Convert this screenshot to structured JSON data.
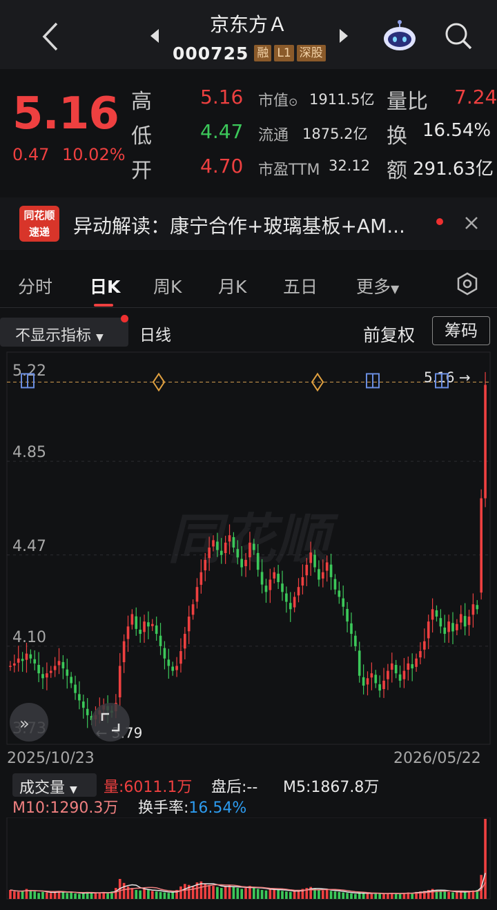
{
  "header": {
    "title": "京东方Ａ",
    "code": "000725",
    "tags": [
      "融",
      "L1",
      "深股"
    ]
  },
  "quote": {
    "price": "5.16",
    "change": "0.47",
    "change_pct": "10.02%",
    "labels": {
      "high": "高",
      "low": "低",
      "open": "开",
      "vol_ratio": "量比",
      "turnover": "换",
      "amount": "额"
    },
    "high": "5.16",
    "low": "4.47",
    "open": "4.70",
    "market_cap_label": "市值",
    "market_cap": "1911.5亿",
    "float_cap_label": "流通",
    "float_cap": "1875.2亿",
    "pe_label": "市盈TTM",
    "pe": "32.12",
    "vol_ratio": "7.24",
    "turnover": "16.54%",
    "amount": "291.63亿"
  },
  "news": {
    "logo_line1": "同花顺",
    "logo_line2": "速递",
    "text": "异动解读：康宁合作+玻璃基板+AM..."
  },
  "tabs": [
    "分时",
    "日K",
    "周K",
    "月K",
    "五日",
    "更多"
  ],
  "active_tab": "日K",
  "subbar": {
    "indicator": "不显示指标",
    "period": "日线",
    "adjust": "前复权",
    "chips": "筹码"
  },
  "chart_data": {
    "type": "candlestick",
    "y_ticks": [
      "5.22",
      "4.85",
      "4.47",
      "4.10",
      "3.73"
    ],
    "ylim": [
      3.73,
      5.22
    ],
    "max_label": "5.16",
    "min_label": "3.79",
    "x_start_label": "2025/10/23",
    "x_end_label": "2026/05/22",
    "watermark": "同花顺",
    "closes": [
      4.02,
      4.03,
      4.05,
      4.04,
      4.07,
      4.05,
      4.03,
      3.99,
      3.97,
      3.99,
      4.0,
      4.02,
      4.04,
      4.01,
      3.98,
      3.95,
      3.91,
      3.88,
      3.85,
      3.82,
      3.8,
      3.82,
      3.84,
      3.86,
      3.84,
      3.83,
      3.87,
      4.02,
      4.12,
      4.18,
      4.23,
      4.17,
      4.15,
      4.2,
      4.18,
      4.19,
      4.15,
      4.1,
      4.05,
      4.02,
      4.0,
      4.02,
      4.08,
      4.15,
      4.22,
      4.27,
      4.34,
      4.4,
      4.45,
      4.5,
      4.53,
      4.49,
      4.47,
      4.52,
      4.55,
      4.5,
      4.46,
      4.42,
      4.45,
      4.52,
      4.49,
      4.41,
      4.35,
      4.32,
      4.37,
      4.4,
      4.36,
      4.32,
      4.28,
      4.25,
      4.3,
      4.34,
      4.38,
      4.43,
      4.48,
      4.42,
      4.37,
      4.4,
      4.44,
      4.38,
      4.33,
      4.3,
      4.26,
      4.2,
      4.15,
      4.1,
      3.98,
      3.94,
      3.97,
      3.99,
      3.95,
      3.92,
      3.96,
      4.0,
      4.03,
      3.99,
      3.96,
      4.0,
      4.03,
      4.01,
      4.05,
      4.08,
      4.12,
      4.2,
      4.25,
      4.22,
      4.18,
      4.15,
      4.2,
      4.16,
      4.19,
      4.23,
      4.18,
      4.22,
      4.27,
      4.25,
      4.7,
      5.16
    ],
    "volumes": [
      18,
      15,
      14,
      16,
      20,
      18,
      15,
      12,
      14,
      13,
      12,
      15,
      16,
      14,
      12,
      13,
      11,
      10,
      12,
      14,
      13,
      11,
      12,
      14,
      13,
      15,
      22,
      40,
      32,
      25,
      22,
      18,
      17,
      20,
      18,
      16,
      15,
      14,
      13,
      12,
      14,
      18,
      25,
      30,
      28,
      26,
      33,
      35,
      30,
      28,
      26,
      24,
      22,
      25,
      28,
      24,
      22,
      20,
      22,
      26,
      24,
      20,
      18,
      17,
      19,
      21,
      18,
      16,
      15,
      14,
      16,
      18,
      20,
      22,
      24,
      20,
      18,
      17,
      19,
      16,
      15,
      14,
      13,
      12,
      11,
      10,
      13,
      12,
      11,
      10,
      12,
      11,
      10,
      11,
      12,
      10,
      11,
      12,
      13,
      12,
      14,
      15,
      16,
      18,
      20,
      18,
      16,
      15,
      14,
      13,
      14,
      15,
      14,
      16,
      17,
      18,
      48,
      160
    ]
  },
  "volume": {
    "button": "成交量",
    "vol_label": "量:",
    "vol_value": "6011.1万",
    "after_hours": "盘后:--",
    "m5_label": "M5:",
    "m5_value": "1867.8万",
    "m10_label": "M10:",
    "m10_value": "1290.3万",
    "turnover_label": "换手率:",
    "turnover_value": "16.54%"
  },
  "colors": {
    "up": "#ee4040",
    "down": "#3cc85a",
    "accent_blue": "#2d9cf0"
  }
}
